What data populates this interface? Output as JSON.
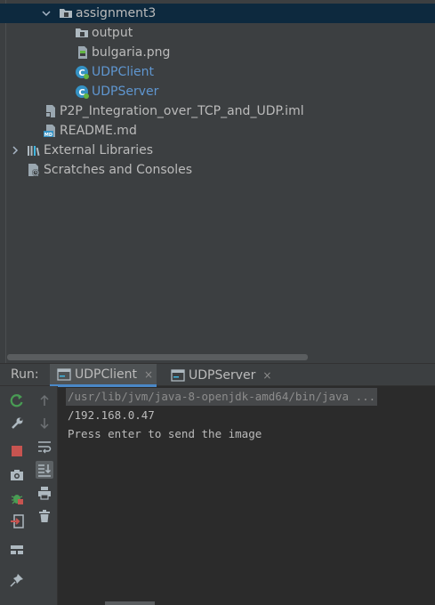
{
  "tree": {
    "items": [
      {
        "label": "assignment3",
        "icon": "folder-icon"
      },
      {
        "label": "output",
        "icon": "folder-icon"
      },
      {
        "label": "bulgaria.png",
        "icon": "image-file-icon"
      },
      {
        "label": "UDPClient",
        "icon": "java-class-icon"
      },
      {
        "label": "UDPServer",
        "icon": "java-class-icon"
      },
      {
        "label": "P2P_Integration_over_TCP_and_UDP.iml",
        "icon": "module-file-icon"
      },
      {
        "label": "README.md",
        "icon": "markdown-file-icon"
      },
      {
        "label": "External Libraries",
        "icon": "libraries-icon"
      },
      {
        "label": "Scratches and Consoles",
        "icon": "scratches-icon"
      }
    ]
  },
  "run": {
    "label": "Run:",
    "tabs": [
      {
        "label": "UDPClient",
        "close": "×",
        "active": true
      },
      {
        "label": "UDPServer",
        "close": "×",
        "active": false
      }
    ],
    "console": [
      "/usr/lib/jvm/java-8-openjdk-amd64/bin/java ...",
      "/192.168.0.47",
      "Press enter to send the image"
    ]
  },
  "colors": {
    "background": "#3c3f41",
    "selection": "#0d293e",
    "console_bg": "#2b2b2b",
    "class_text": "#5f96d0",
    "accent": "#4a88c7",
    "stop_red": "#c75450",
    "rerun_green": "#499c54"
  }
}
